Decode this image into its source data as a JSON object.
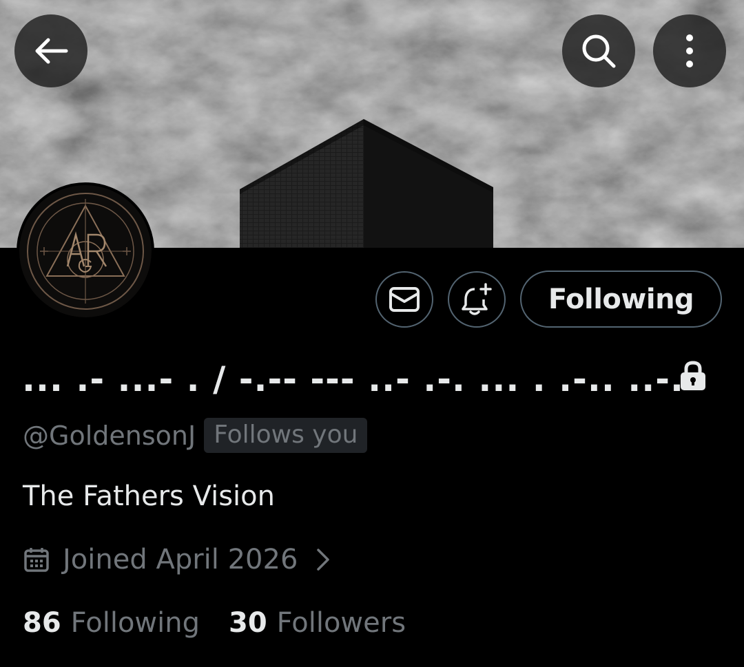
{
  "header": {
    "back_icon": "arrow-left-icon",
    "search_icon": "search-icon",
    "more_icon": "more-vertical-icon"
  },
  "profile": {
    "display_name": "... .- ...- . / -.-- --- ..- .-. ... . .-.. ..-.",
    "locked_icon": "lock-icon",
    "handle": "@GoldensonJ",
    "follows_you_label": "Follows you",
    "bio": "The Fathers Vision",
    "joined": "Joined April 2026",
    "following_count": "86",
    "following_label": "Following",
    "followers_count": "30",
    "followers_label": "Followers"
  },
  "actions": {
    "message_icon": "mail-icon",
    "notify_icon": "bell-plus-icon",
    "follow_button_label": "Following"
  },
  "colors": {
    "background": "#000000",
    "primary_text": "#e7e9ea",
    "secondary_text": "#71767b",
    "border": "#536471",
    "badge_bg": "#202327"
  }
}
